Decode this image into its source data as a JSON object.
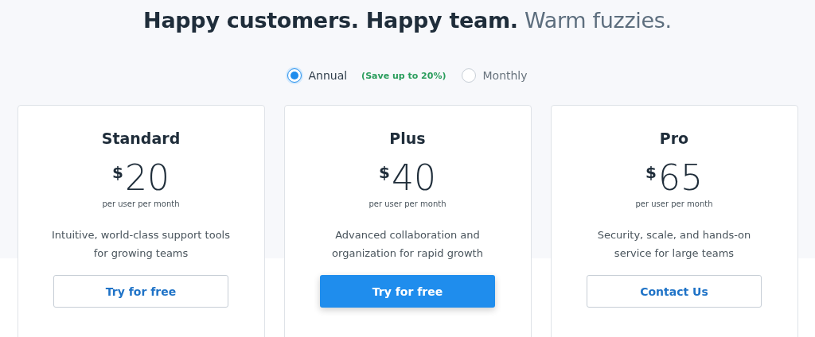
{
  "heading": "**Happy customers. Happy team.** Warm fuzzies.",
  "billing": [
    {
      "label": "Annual",
      "note": "(Save up to 20%)",
      "selected": true
    },
    {
      "label": "Monthly",
      "selected": false
    }
  ],
  "plans": [
    {
      "name": "Standard",
      "currency": "$",
      "price": "20",
      "period": "per user per month",
      "description": "Intuitive, world-class support tools for growing teams",
      "button": "Try for free",
      "primary": false
    },
    {
      "name": "Plus",
      "currency": "$",
      "price": "40",
      "period": "per user per month",
      "description": "Advanced collaboration and organization for rapid growth",
      "button": "Try for free",
      "primary": true
    },
    {
      "name": "Pro",
      "currency": "$",
      "price": "65",
      "period": "per user per month",
      "description": "Security, scale, and hands-on service for large teams",
      "button": "Contact Us",
      "primary": false
    }
  ]
}
